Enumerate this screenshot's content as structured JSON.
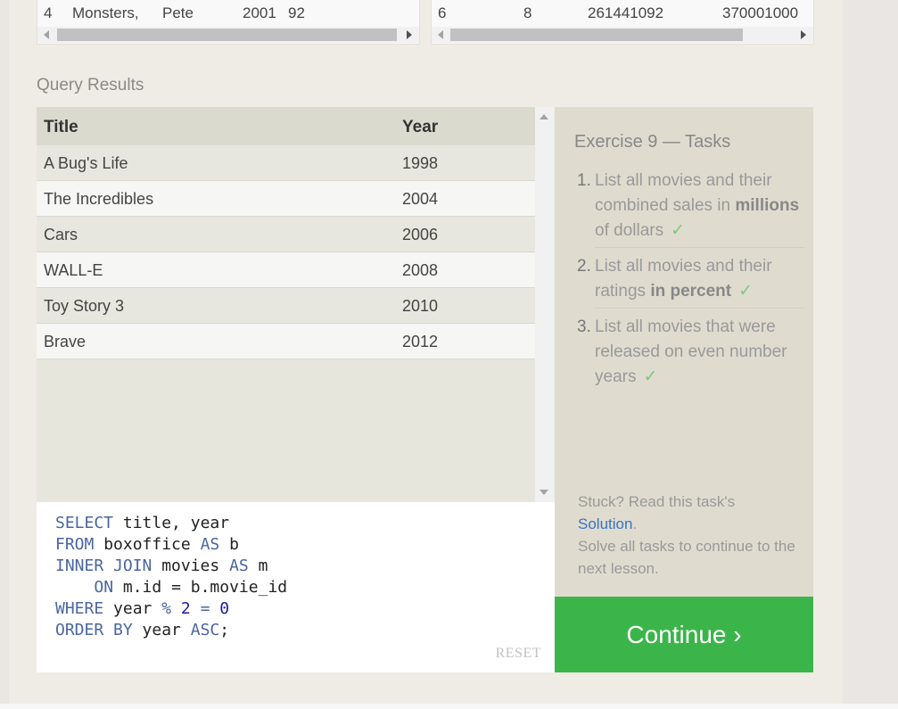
{
  "top_left_table": {
    "row": [
      "4",
      "Monsters,",
      "Pete",
      "2001",
      "92"
    ]
  },
  "top_right_table": {
    "row": [
      "6",
      "8",
      "261441092",
      "370001000"
    ]
  },
  "query_results": {
    "label": "Query Results",
    "columns": [
      "Title",
      "Year"
    ],
    "rows": [
      [
        "A Bug's Life",
        "1998"
      ],
      [
        "The Incredibles",
        "2004"
      ],
      [
        "Cars",
        "2006"
      ],
      [
        "WALL-E",
        "2008"
      ],
      [
        "Toy Story 3",
        "2010"
      ],
      [
        "Brave",
        "2012"
      ]
    ]
  },
  "editor": {
    "lines": [
      {
        "kw1": "SELECT",
        "rest": " title, year"
      },
      {
        "kw1": "FROM",
        "rest": " boxoffice ",
        "kw2": "AS",
        "rest2": " b"
      },
      {
        "kw1": "INNER JOIN",
        "rest": " movies ",
        "kw2": "AS",
        "rest2": " m"
      },
      {
        "indent": "    ",
        "kw1": "ON",
        "rest": " m.id = b.movie_id"
      },
      {
        "kw1": "WHERE",
        "rest": " year ",
        "op": "%",
        "sp": " ",
        "n1": "2",
        "eq": " = ",
        "n2": "0"
      },
      {
        "kw1": "ORDER BY",
        "rest": " year ",
        "kw2": "ASC",
        "rest2": ";"
      }
    ],
    "reset_label": "RESET"
  },
  "tasks": {
    "title": "Exercise 9 — Tasks",
    "items": [
      {
        "num": "1.",
        "pre": "List all movies and their combined sales in ",
        "bold": "millions",
        "post": " of dollars",
        "check": "✓"
      },
      {
        "num": "2.",
        "pre": "List all movies and their ratings ",
        "bold": "in percent",
        "post": "",
        "check": "✓"
      },
      {
        "num": "3.",
        "pre": "List all movies that were released on even number years",
        "bold": "",
        "post": "",
        "check": "✓"
      }
    ],
    "stuck_text": "Stuck? Read this task's",
    "solution_link": "Solution",
    "solution_period": ".",
    "solve_text": "Solve all tasks to continue to the next lesson."
  },
  "continue_button": {
    "label": "Continue ›",
    "color": "#3bb54a"
  }
}
